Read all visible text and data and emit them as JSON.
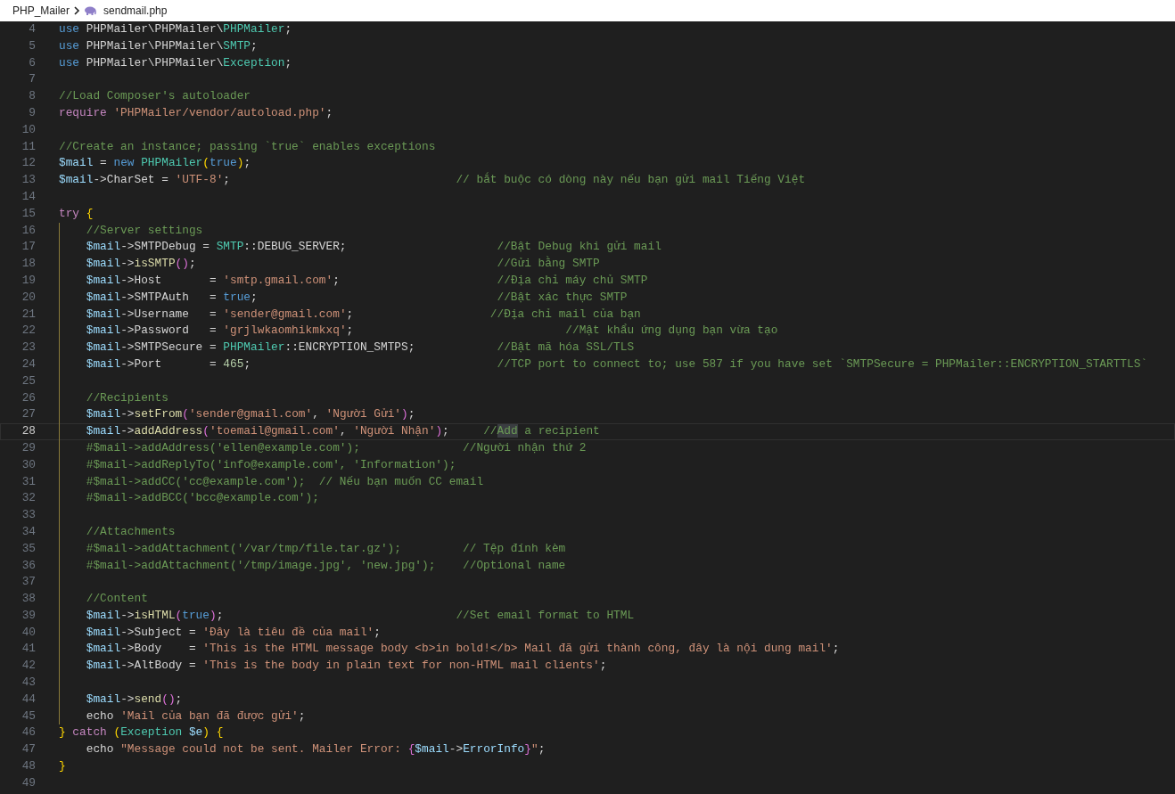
{
  "breadcrumb": {
    "folder": "PHP_Mailer",
    "file": "sendmail.php"
  },
  "lines": [
    {
      "number": "4",
      "selected": false,
      "guide": false,
      "tokens": [
        {
          "kind": "keyword",
          "text": "use"
        },
        {
          "kind": "plain",
          "text": " PHPMailer\\PHPMailer\\"
        },
        {
          "kind": "class",
          "text": "PHPMailer"
        },
        {
          "kind": "plain",
          "text": ";"
        }
      ]
    },
    {
      "number": "5",
      "selected": false,
      "guide": false,
      "tokens": [
        {
          "kind": "keyword",
          "text": "use"
        },
        {
          "kind": "plain",
          "text": " PHPMailer\\PHPMailer\\"
        },
        {
          "kind": "class",
          "text": "SMTP"
        },
        {
          "kind": "plain",
          "text": ";"
        }
      ]
    },
    {
      "number": "6",
      "selected": false,
      "guide": false,
      "tokens": [
        {
          "kind": "keyword",
          "text": "use"
        },
        {
          "kind": "plain",
          "text": " PHPMailer\\PHPMailer\\"
        },
        {
          "kind": "class",
          "text": "Exception"
        },
        {
          "kind": "plain",
          "text": ";"
        }
      ]
    },
    {
      "number": "7",
      "selected": false,
      "guide": false
    },
    {
      "number": "8",
      "selected": false,
      "guide": false,
      "tokens": [
        {
          "kind": "comment",
          "text": "//Load Composer's autoloader"
        }
      ]
    },
    {
      "number": "9",
      "selected": false,
      "guide": false,
      "tokens": [
        {
          "kind": "control",
          "text": "require"
        },
        {
          "kind": "string",
          "text": " 'PHPMailer/vendor/autoload.php'"
        },
        {
          "kind": "plain",
          "text": ";"
        }
      ]
    },
    {
      "number": "10",
      "selected": false,
      "guide": false
    },
    {
      "number": "11",
      "selected": false,
      "guide": false,
      "tokens": [
        {
          "kind": "comment",
          "text": "//Create an instance; passing `true` enables exceptions"
        }
      ]
    },
    {
      "number": "12",
      "selected": false,
      "guide": false,
      "tokens": [
        {
          "kind": "variable",
          "text": "$mail"
        },
        {
          "kind": "plain",
          "text": " = "
        },
        {
          "kind": "keyword",
          "text": "new"
        },
        {
          "kind": "class",
          "text": " PHPMailer"
        },
        {
          "kind": "bracket1",
          "text": "("
        },
        {
          "kind": "keyword",
          "text": "true"
        },
        {
          "kind": "bracket1",
          "text": ")"
        },
        {
          "kind": "plain",
          "text": ";"
        }
      ]
    },
    {
      "number": "13",
      "selected": false,
      "guide": false,
      "tokens": [
        {
          "kind": "variable",
          "text": "$mail"
        },
        {
          "kind": "plain",
          "text": "->CharSet = "
        },
        {
          "kind": "string",
          "text": "'UTF-8'"
        },
        {
          "kind": "plain",
          "text": ";"
        },
        {
          "kind": "comment",
          "text": "                                 // bắt buộc có dòng này nếu bạn gửi mail Tiếng Việt"
        }
      ]
    },
    {
      "number": "14",
      "selected": false,
      "guide": false
    },
    {
      "number": "15",
      "selected": false,
      "guide": false,
      "tokens": [
        {
          "kind": "control",
          "text": "try"
        },
        {
          "kind": "bracket1",
          "text": " {"
        }
      ]
    },
    {
      "number": "16",
      "selected": false,
      "guide": true,
      "tokens": [
        {
          "kind": "comment",
          "text": "    //Server settings"
        }
      ]
    },
    {
      "number": "17",
      "selected": false,
      "guide": true,
      "tokens": [
        {
          "kind": "variable",
          "text": "    $mail"
        },
        {
          "kind": "plain",
          "text": "->SMTPDebug = "
        },
        {
          "kind": "class",
          "text": "SMTP"
        },
        {
          "kind": "plain",
          "text": "::DEBUG_SERVER;"
        },
        {
          "kind": "comment",
          "text": "                      //Bật Debug khi gửi mail"
        }
      ]
    },
    {
      "number": "18",
      "selected": false,
      "guide": true,
      "tokens": [
        {
          "kind": "variable",
          "text": "    $mail"
        },
        {
          "kind": "plain",
          "text": "->"
        },
        {
          "kind": "function",
          "text": "isSMTP"
        },
        {
          "kind": "bracket2",
          "text": "()"
        },
        {
          "kind": "plain",
          "text": ";"
        },
        {
          "kind": "comment",
          "text": "                                            //Gửi bằng SMTP"
        }
      ]
    },
    {
      "number": "19",
      "selected": false,
      "guide": true,
      "tokens": [
        {
          "kind": "variable",
          "text": "    $mail"
        },
        {
          "kind": "plain",
          "text": "->Host       = "
        },
        {
          "kind": "string",
          "text": "'smtp.gmail.com'"
        },
        {
          "kind": "plain",
          "text": ";"
        },
        {
          "kind": "comment",
          "text": "                       //Địa chỉ máy chủ SMTP"
        }
      ]
    },
    {
      "number": "20",
      "selected": false,
      "guide": true,
      "tokens": [
        {
          "kind": "variable",
          "text": "    $mail"
        },
        {
          "kind": "plain",
          "text": "->SMTPAuth   = "
        },
        {
          "kind": "keyword",
          "text": "true"
        },
        {
          "kind": "plain",
          "text": ";"
        },
        {
          "kind": "comment",
          "text": "                                   //Bật xác thực SMTP"
        }
      ]
    },
    {
      "number": "21",
      "selected": false,
      "guide": true,
      "tokens": [
        {
          "kind": "variable",
          "text": "    $mail"
        },
        {
          "kind": "plain",
          "text": "->Username   = "
        },
        {
          "kind": "string",
          "text": "'sender@gmail.com'"
        },
        {
          "kind": "plain",
          "text": ";"
        },
        {
          "kind": "comment",
          "text": "                    //Địa chỉ mail của bạn"
        }
      ]
    },
    {
      "number": "22",
      "selected": false,
      "guide": true,
      "tokens": [
        {
          "kind": "variable",
          "text": "    $mail"
        },
        {
          "kind": "plain",
          "text": "->Password   = "
        },
        {
          "kind": "string",
          "text": "'grjlwkaomhikmkxq'"
        },
        {
          "kind": "plain",
          "text": ";"
        },
        {
          "kind": "comment",
          "text": "                               //Mật khẩu ứng dụng bạn vừa tạo"
        }
      ]
    },
    {
      "number": "23",
      "selected": false,
      "guide": true,
      "tokens": [
        {
          "kind": "variable",
          "text": "    $mail"
        },
        {
          "kind": "plain",
          "text": "->SMTPSecure = "
        },
        {
          "kind": "class",
          "text": "PHPMailer"
        },
        {
          "kind": "plain",
          "text": "::ENCRYPTION_SMTPS;"
        },
        {
          "kind": "comment",
          "text": "            //Bật mã hóa SSL/TLS"
        }
      ]
    },
    {
      "number": "24",
      "selected": false,
      "guide": true,
      "tokens": [
        {
          "kind": "variable",
          "text": "    $mail"
        },
        {
          "kind": "plain",
          "text": "->Port       = "
        },
        {
          "kind": "number",
          "text": "465"
        },
        {
          "kind": "plain",
          "text": ";"
        },
        {
          "kind": "comment",
          "text": "                                    //TCP port to connect to; use 587 if you have set `SMTPSecure = PHPMailer::ENCRYPTION_STARTTLS`"
        }
      ]
    },
    {
      "number": "25",
      "selected": false,
      "guide": true
    },
    {
      "number": "26",
      "selected": false,
      "guide": true,
      "tokens": [
        {
          "kind": "comment",
          "text": "    //Recipients"
        }
      ]
    },
    {
      "number": "27",
      "selected": false,
      "guide": true,
      "tokens": [
        {
          "kind": "variable",
          "text": "    $mail"
        },
        {
          "kind": "plain",
          "text": "->"
        },
        {
          "kind": "function",
          "text": "setFrom"
        },
        {
          "kind": "bracket2",
          "text": "("
        },
        {
          "kind": "string",
          "text": "'sender@gmail.com'"
        },
        {
          "kind": "plain",
          "text": ", "
        },
        {
          "kind": "string",
          "text": "'Người Gửi'"
        },
        {
          "kind": "bracket2",
          "text": ")"
        },
        {
          "kind": "plain",
          "text": ";"
        }
      ]
    },
    {
      "number": "28",
      "selected": true,
      "guide": true,
      "tokens": [
        {
          "kind": "variable",
          "text": "    $mail"
        },
        {
          "kind": "plain",
          "text": "->"
        },
        {
          "kind": "function",
          "text": "addAddress"
        },
        {
          "kind": "bracket2",
          "text": "("
        },
        {
          "kind": "string",
          "text": "'toemail@gmail.com'"
        },
        {
          "kind": "plain",
          "text": ", "
        },
        {
          "kind": "string",
          "text": "'Người Nhận'"
        },
        {
          "kind": "bracket2",
          "text": ")"
        },
        {
          "kind": "plain",
          "text": ";"
        },
        {
          "kind": "comment",
          "text": "     //"
        },
        {
          "kind": "match",
          "text": "Add"
        },
        {
          "kind": "comment",
          "text": " a recipient"
        }
      ]
    },
    {
      "number": "29",
      "selected": false,
      "guide": true,
      "tokens": [
        {
          "kind": "comment",
          "text": "    #$mail->addAddress('ellen@example.com');               //Người nhận thứ 2"
        }
      ]
    },
    {
      "number": "30",
      "selected": false,
      "guide": true,
      "tokens": [
        {
          "kind": "comment",
          "text": "    #$mail->addReplyTo('info@example.com', 'Information');"
        }
      ]
    },
    {
      "number": "31",
      "selected": false,
      "guide": true,
      "tokens": [
        {
          "kind": "comment",
          "text": "    #$mail->addCC('cc@example.com');  // Nếu bạn muốn CC email"
        }
      ]
    },
    {
      "number": "32",
      "selected": false,
      "guide": true,
      "tokens": [
        {
          "kind": "comment",
          "text": "    #$mail->addBCC('bcc@example.com');"
        }
      ]
    },
    {
      "number": "33",
      "selected": false,
      "guide": true
    },
    {
      "number": "34",
      "selected": false,
      "guide": true,
      "tokens": [
        {
          "kind": "comment",
          "text": "    //Attachments"
        }
      ]
    },
    {
      "number": "35",
      "selected": false,
      "guide": true,
      "tokens": [
        {
          "kind": "comment",
          "text": "    #$mail->addAttachment('/var/tmp/file.tar.gz');         // Tệp đính kèm"
        }
      ]
    },
    {
      "number": "36",
      "selected": false,
      "guide": true,
      "tokens": [
        {
          "kind": "comment",
          "text": "    #$mail->addAttachment('/tmp/image.jpg', 'new.jpg');    //Optional name"
        }
      ]
    },
    {
      "number": "37",
      "selected": false,
      "guide": true
    },
    {
      "number": "38",
      "selected": false,
      "guide": true,
      "tokens": [
        {
          "kind": "comment",
          "text": "    //Content"
        }
      ]
    },
    {
      "number": "39",
      "selected": false,
      "guide": true,
      "tokens": [
        {
          "kind": "variable",
          "text": "    $mail"
        },
        {
          "kind": "plain",
          "text": "->"
        },
        {
          "kind": "function",
          "text": "isHTML"
        },
        {
          "kind": "bracket2",
          "text": "("
        },
        {
          "kind": "keyword",
          "text": "true"
        },
        {
          "kind": "bracket2",
          "text": ")"
        },
        {
          "kind": "plain",
          "text": ";"
        },
        {
          "kind": "comment",
          "text": "                                  //Set email format to HTML"
        }
      ]
    },
    {
      "number": "40",
      "selected": false,
      "guide": true,
      "tokens": [
        {
          "kind": "variable",
          "text": "    $mail"
        },
        {
          "kind": "plain",
          "text": "->Subject = "
        },
        {
          "kind": "string",
          "text": "'Đây là tiêu đề của mail'"
        },
        {
          "kind": "plain",
          "text": ";"
        }
      ]
    },
    {
      "number": "41",
      "selected": false,
      "guide": true,
      "tokens": [
        {
          "kind": "variable",
          "text": "    $mail"
        },
        {
          "kind": "plain",
          "text": "->Body    = "
        },
        {
          "kind": "string",
          "text": "'This is the HTML message body <b>in bold!</b> Mail đã gửi thành công, đây là nội dung mail'"
        },
        {
          "kind": "plain",
          "text": ";"
        }
      ]
    },
    {
      "number": "42",
      "selected": false,
      "guide": true,
      "tokens": [
        {
          "kind": "variable",
          "text": "    $mail"
        },
        {
          "kind": "plain",
          "text": "->AltBody = "
        },
        {
          "kind": "string",
          "text": "'This is the body in plain text for non-HTML mail clients'"
        },
        {
          "kind": "plain",
          "text": ";"
        }
      ]
    },
    {
      "number": "43",
      "selected": false,
      "guide": true
    },
    {
      "number": "44",
      "selected": false,
      "guide": true,
      "tokens": [
        {
          "kind": "variable",
          "text": "    $mail"
        },
        {
          "kind": "plain",
          "text": "->"
        },
        {
          "kind": "function",
          "text": "send"
        },
        {
          "kind": "bracket2",
          "text": "()"
        },
        {
          "kind": "plain",
          "text": ";"
        }
      ]
    },
    {
      "number": "45",
      "selected": false,
      "guide": true,
      "tokens": [
        {
          "kind": "plain",
          "text": "    echo "
        },
        {
          "kind": "string",
          "text": "'Mail của bạn đã được gửi'"
        },
        {
          "kind": "plain",
          "text": ";"
        }
      ]
    },
    {
      "number": "46",
      "selected": false,
      "guide": false,
      "tokens": [
        {
          "kind": "bracket1",
          "text": "}"
        },
        {
          "kind": "control",
          "text": " catch"
        },
        {
          "kind": "bracket1",
          "text": " ("
        },
        {
          "kind": "class",
          "text": "Exception"
        },
        {
          "kind": "variable",
          "text": " $e"
        },
        {
          "kind": "bracket1",
          "text": ")"
        },
        {
          "kind": "bracket1",
          "text": " {"
        }
      ]
    },
    {
      "number": "47",
      "selected": false,
      "guide": false,
      "tokens": [
        {
          "kind": "plain",
          "text": "    echo "
        },
        {
          "kind": "string",
          "text": "\"Message could not be sent. Mailer Error: "
        },
        {
          "kind": "bracket2",
          "text": "{"
        },
        {
          "kind": "variable",
          "text": "$mail"
        },
        {
          "kind": "plain",
          "text": "->"
        },
        {
          "kind": "variable",
          "text": "ErrorInfo"
        },
        {
          "kind": "bracket2",
          "text": "}"
        },
        {
          "kind": "string",
          "text": "\""
        },
        {
          "kind": "plain",
          "text": ";"
        }
      ]
    },
    {
      "number": "48",
      "selected": false,
      "guide": false,
      "tokens": [
        {
          "kind": "bracket1",
          "text": "}"
        }
      ]
    },
    {
      "number": "49",
      "selected": false,
      "guide": false
    }
  ]
}
